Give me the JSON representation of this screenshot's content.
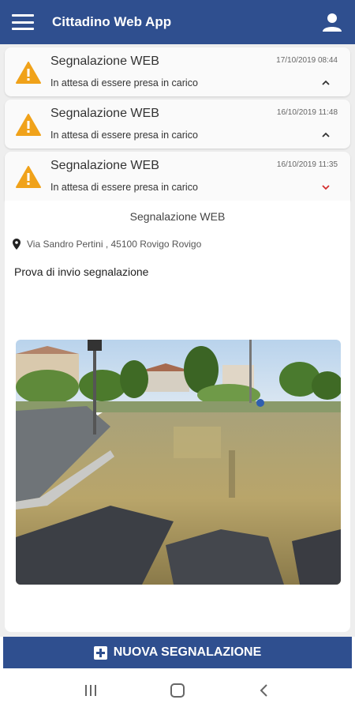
{
  "appbar": {
    "title": "Cittadino Web App",
    "menu_icon": "hamburger-menu-icon",
    "profile_icon": "user-profile-icon",
    "color": "#2f4f8f"
  },
  "reports": [
    {
      "title": "Segnalazione WEB",
      "date": "17/10/2019 08:44",
      "status": "In attesa di essere presa in carico",
      "icon": "warning-icon",
      "expanded": false
    },
    {
      "title": "Segnalazione WEB",
      "date": "16/10/2019 11:48",
      "status": "In attesa di essere presa in carico",
      "icon": "warning-icon",
      "expanded": false
    },
    {
      "title": "Segnalazione WEB",
      "date": "16/10/2019 11:35",
      "status": "In attesa di essere presa in carico",
      "icon": "warning-icon",
      "expanded": true
    }
  ],
  "detail": {
    "title": "Segnalazione WEB",
    "address": "Via Sandro Pertini , 45100 Rovigo Rovigo",
    "address_icon": "map-pin-icon",
    "description": "Prova di invio segnalazione",
    "photo": "flooded-street-photo"
  },
  "cta": {
    "label": "NUOVA SEGNALAZIONE",
    "icon": "plus-square-icon"
  },
  "system_nav": {
    "recents_icon": "recents-icon",
    "home_icon": "home-icon",
    "back_icon": "back-icon"
  },
  "colors": {
    "primary": "#2f4f8f",
    "warning": "#f0a21a",
    "chevron_active": "#d32f2f"
  }
}
